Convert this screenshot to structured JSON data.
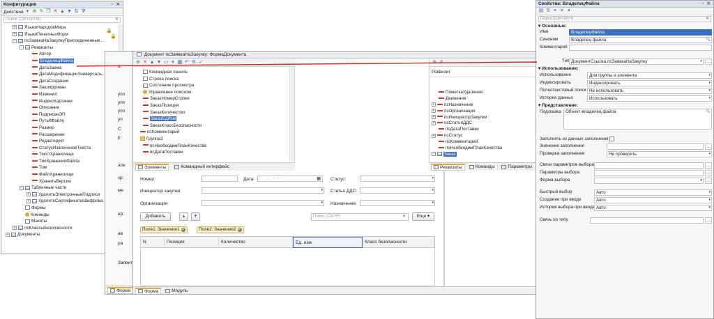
{
  "config_window": {
    "title": "Конфигурация",
    "actions_label": "Действия",
    "search_placeholder": "Поиск (Ctrl+Alt+M)",
    "tree": [
      {
        "label": "ЯзыкиНародовМира",
        "level": 1,
        "icon": "table-icon",
        "exp": "+"
      },
      {
        "label": "ЯзыкиПечатныхФорм",
        "level": 1,
        "icon": "table-icon",
        "exp": "+"
      },
      {
        "label": "псЗаявкаНаЗакупкуПрисоединенные...",
        "level": 1,
        "icon": "table-icon",
        "exp": "-"
      },
      {
        "label": "Реквизиты",
        "level": 2,
        "icon": "attributes-icon",
        "exp": "-"
      },
      {
        "label": "Автор",
        "level": 3,
        "icon": "attr-icon"
      },
      {
        "label": "ВладелецФайла",
        "level": 3,
        "icon": "attr-icon",
        "selected": true
      },
      {
        "label": "ДатаЗаема",
        "level": 3,
        "icon": "attr-icon"
      },
      {
        "label": "ДатаМодификацииУниверсаль...",
        "level": 3,
        "icon": "attr-icon"
      },
      {
        "label": "ДатаСоздания",
        "level": 3,
        "icon": "attr-icon"
      },
      {
        "label": "Зашифрован",
        "level": 3,
        "icon": "attr-icon"
      },
      {
        "label": "Изменил",
        "level": 3,
        "icon": "attr-icon"
      },
      {
        "label": "ИндексКартинки",
        "level": 3,
        "icon": "attr-icon"
      },
      {
        "label": "Описание",
        "level": 3,
        "icon": "attr-icon"
      },
      {
        "label": "ПодписанЭП",
        "level": 3,
        "icon": "attr-icon"
      },
      {
        "label": "ПутьКФайлу",
        "level": 3,
        "icon": "attr-icon"
      },
      {
        "label": "Размер",
        "level": 3,
        "icon": "attr-icon"
      },
      {
        "label": "Расширение",
        "level": 3,
        "icon": "attr-icon"
      },
      {
        "label": "Редактирует",
        "level": 3,
        "icon": "attr-icon"
      },
      {
        "label": "СтатусИзвлеченияТекста",
        "level": 3,
        "icon": "attr-icon"
      },
      {
        "label": "ТекстХранилище",
        "level": 3,
        "icon": "attr-icon"
      },
      {
        "label": "ТипХраненияФайла",
        "level": 3,
        "icon": "attr-icon"
      },
      {
        "label": "Том",
        "level": 3,
        "icon": "attr-icon"
      },
      {
        "label": "ФайлХранилище",
        "level": 3,
        "icon": "attr-icon"
      },
      {
        "label": "ХранитьВерсии",
        "level": 3,
        "icon": "attr-icon"
      },
      {
        "label": "Табличные части",
        "level": 2,
        "icon": "table-icon",
        "exp": "-"
      },
      {
        "label": "УдалитьЭлектронныеПодписи",
        "level": 3,
        "icon": "table-icon",
        "exp": "+"
      },
      {
        "label": "УдалитьСертификатыШифрова...",
        "level": 3,
        "icon": "table-icon",
        "exp": "+"
      },
      {
        "label": "Формы",
        "level": 2,
        "icon": "form-icon"
      },
      {
        "label": "Команды",
        "level": 2,
        "icon": "command-icon"
      },
      {
        "label": "Макеты",
        "level": 2,
        "icon": "form-icon"
      },
      {
        "label": "псКлассыБезопасности",
        "level": 1,
        "icon": "table-icon",
        "exp": "+"
      },
      {
        "label": "Документы",
        "level": 0,
        "icon": "table-icon",
        "exp": "+"
      }
    ]
  },
  "form_window": {
    "title": "Документ псЗаявкаНаЗакупку: ФормаДокумента",
    "elements_tree": [
      {
        "label": "Командная панель",
        "icon": "form-icon"
      },
      {
        "label": "Строка поиска",
        "icon": "form-icon"
      },
      {
        "label": "Состояние просмотра",
        "icon": "form-icon"
      },
      {
        "label": "Управление поиском",
        "icon": "command-icon"
      },
      {
        "label": "ЗаказНомерСтроки",
        "icon": "attr-icon"
      },
      {
        "label": "ЗаказПозиция",
        "icon": "attr-icon"
      },
      {
        "label": "ЗаказКоличество",
        "icon": "attr-icon"
      },
      {
        "label": "ЗаказЕдИзм",
        "icon": "attr-icon",
        "selected": true
      },
      {
        "label": "ЗаказКлассБезопасности",
        "icon": "attr-icon"
      },
      {
        "label": "псКомментарий",
        "icon": "attr-icon"
      },
      {
        "label": "Группа3",
        "icon": "group-icon"
      },
      {
        "label": "псНеобходимПланКачества",
        "icon": "attr-icon"
      },
      {
        "label": "псДатаПоставки",
        "icon": "attr-icon"
      }
    ],
    "attributes_header": "Реквизит",
    "attributes_tree": [
      {
        "label": "ПометкаУдаления",
        "exp": ""
      },
      {
        "label": "Движения",
        "exp": ""
      },
      {
        "label": "псНазначение",
        "exp": "+"
      },
      {
        "label": "псОрганизация",
        "exp": "+"
      },
      {
        "label": "псИнициаторЗакупки",
        "exp": "+"
      },
      {
        "label": "псСтатьяДДС",
        "exp": "+"
      },
      {
        "label": "псДатаПоставки",
        "exp": ""
      },
      {
        "label": "псСтатус",
        "exp": "+"
      },
      {
        "label": "псКомментарий",
        "exp": ""
      },
      {
        "label": "псНеобходимПланКачества",
        "exp": ""
      },
      {
        "label": "Заказ",
        "exp": "-",
        "selected": true
      }
    ],
    "tabs_elements": [
      {
        "label": "Элементы",
        "active": true
      },
      {
        "label": "Командный интерфейс",
        "active": false
      }
    ],
    "tabs_attributes": [
      {
        "label": "Реквизиты",
        "active": true
      },
      {
        "label": "Команды",
        "active": false
      },
      {
        "label": "Параметры",
        "active": false
      }
    ],
    "preview": {
      "number_label": "Номер:",
      "date_label": "Дата:",
      "date_value": ". .  : :",
      "status_label": "Статус:",
      "initiator_label": "Инициатор закупки:",
      "dds_label": "Статья ДДС:",
      "org_label": "Организация:",
      "purpose_label": "Назначение:",
      "add_button": "Добавить",
      "search_placeholder": "Поиск (Ctrl+F)",
      "more_button": "Еще",
      "group_tags": [
        "Поле1: Значение1",
        "Поле2: Значение2"
      ],
      "table_headers": [
        "N",
        "Позиция",
        "Количество",
        "Ед. изм.",
        "Класс безопасности"
      ]
    },
    "bottom_tabs": [
      {
        "label": "Форма",
        "active": true
      },
      {
        "label": "Модуль",
        "active": false
      }
    ]
  },
  "behind_window": {
    "tab_label": "Форма",
    "fragments": [
      "а",
      "упп",
      "упп",
      "упп",
      "уп",
      "С",
      "р",
      "эле",
      "зр:",
      "ме",
      "ер:",
      "ав",
      "ра",
      "Заявит"
    ]
  },
  "properties": {
    "title": "Свойства: ВладелецФайла",
    "search_placeholder": "Поиск (Ctrl+Alt+I)",
    "sections": {
      "main": "Основные:",
      "usage": "Использование:",
      "presentation": "Представление:"
    },
    "name_label": "Имя",
    "name_value": "ВладелецФайла",
    "synonym_label": "Синоним",
    "synonym_value": "Владелец файла",
    "comment_label": "Комментарий",
    "type_label": "Тип",
    "type_value": "ДокументСсылка.псЗаявкаНаЗакупку",
    "usage_label": "Использование",
    "usage_value": "Для группы и элемента",
    "indexing_label": "Индексировать",
    "indexing_value": "Индексировать",
    "fulltext_label": "Полнотекстовый поиск",
    "fulltext_value": "Не использовать",
    "history_label": "История данных",
    "history_value": "Использовать",
    "hint_label": "Подсказка",
    "hint_value": "Объект-владелец файла",
    "fill_from_label": "Заполнять из данных заполнения",
    "fill_value_label": "Значение заполнения",
    "check_fill_label": "Проверка заполнения",
    "check_fill_value": "Не проверять",
    "choice_links_label": "Связи параметров выбора",
    "choice_params_label": "Параметры выбора",
    "choice_form_label": "Форма выбора",
    "quick_choice_label": "Быстрый выбор",
    "quick_choice_value": "Авто",
    "create_on_input_label": "Создание при вводе",
    "create_on_input_value": "Авто",
    "input_history_label": "История выбора при вводе",
    "input_history_value": "Авто",
    "type_link_label": "Связь по типу"
  },
  "accent_colors": {
    "selection": "#3c6fc4",
    "arrow_line": "#d9261c",
    "active_tab": "#e6a83b"
  }
}
